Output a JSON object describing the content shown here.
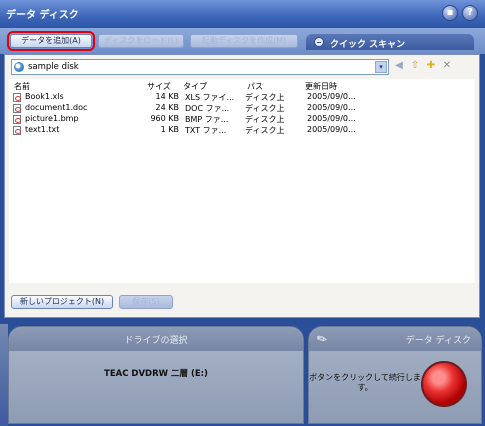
{
  "window": {
    "title": "データ ディスク",
    "buttons": [
      "save-icon",
      "help-icon"
    ],
    "help_glyph": "?"
  },
  "toolbar": {
    "add_data": "データを追加(A)",
    "load_disk": "ディスクをロード(L)",
    "create_boot": "起動ディスクを作成(M)",
    "quick_scan": "クイック スキャン"
  },
  "address": {
    "value": "sample disk",
    "dropdown_glyph": "▾"
  },
  "file_table": {
    "headers": [
      "名前",
      "サイズ",
      "タイプ",
      "パス",
      "更新日時"
    ],
    "rows": [
      [
        "Book1.xls",
        "14 KB",
        "XLS ファイ...",
        "ディスク上",
        "2005/09/0..."
      ],
      [
        "document1.doc",
        "24 KB",
        "DOC ファ...",
        "ディスク上",
        "2005/09/0..."
      ],
      [
        "picture1.bmp",
        "960 KB",
        "BMP ファ...",
        "ディスク上",
        "2005/09/0..."
      ],
      [
        "text1.txt",
        "1 KB",
        "TXT ファ...",
        "ディスク上",
        "2005/09/0..."
      ]
    ]
  },
  "bottom_buttons": {
    "new_project": "新しいプロジェクト(N)",
    "save": "保存(S)"
  },
  "drive_panel": {
    "title": "ドライブの選択",
    "drive": "TEAC DVDRW 二層 (E:)"
  },
  "action_panel": {
    "title": "データ ディスク",
    "instruction": "ボタンをクリックして続行します。"
  }
}
